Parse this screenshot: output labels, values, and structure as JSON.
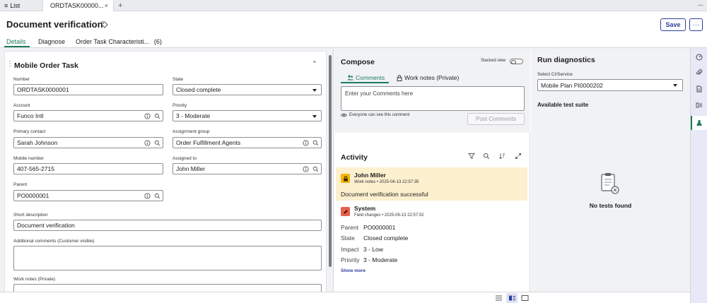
{
  "tabstrip": {
    "list_label": "List",
    "active_tab_label": "ORDTASK00000...",
    "close_glyph": "×",
    "plus_glyph": "+",
    "more_glyph": "···"
  },
  "header": {
    "title": "Document verification",
    "save_label": "Save",
    "more_label": "···"
  },
  "form_tabs": {
    "details": "Details",
    "diagnose": "Diagnose",
    "characteristics": "Order Task Characteristi...",
    "characteristics_count": "(6)"
  },
  "card": {
    "title": "Mobile Order Task",
    "drag_glyph": "⋮",
    "collapse_glyph": "⌃"
  },
  "fields": {
    "number": {
      "label": "Number",
      "value": "ORDTASK0000001"
    },
    "state": {
      "label": "State",
      "value": "Closed complete"
    },
    "account": {
      "label": "Account",
      "value": "Funco Intl"
    },
    "priority": {
      "label": "Priority",
      "value": "3 - Moderate"
    },
    "primary_contact": {
      "label": "Primary contact",
      "value": "Sarah Johnson"
    },
    "assignment_group": {
      "label": "Assignment group",
      "value": "Order Fulfillment Agents"
    },
    "mobile_number": {
      "label": "Mobile number",
      "value": "407-565-2715"
    },
    "assigned_to": {
      "label": "Assigned to",
      "value": "John Miller"
    },
    "parent": {
      "label": "Parent",
      "value": "PO0000001"
    },
    "short_description": {
      "label": "Short description",
      "value": "Document verification"
    },
    "additional_comments": {
      "label": "Additional comments (Customer visible)"
    },
    "work_notes": {
      "label": "Work notes (Private)"
    }
  },
  "compose": {
    "title": "Compose",
    "stacked_view_label": "Stacked view",
    "tab_comments": "Comments",
    "tab_work_notes": "Work notes (Private)",
    "comment_placeholder": "Enter your Comments here",
    "visibility_note": "Everyone can see this comment",
    "post_label": "Post Comments"
  },
  "activity": {
    "title": "Activity",
    "entry1": {
      "name": "John Miller",
      "meta": "Work notes • 2025-06-13 22:57:35",
      "text": "Document verification successful"
    },
    "entry2": {
      "name": "System",
      "meta": "Field changes • 2025-06-13 22:57:02",
      "changes": [
        {
          "key": "Parent",
          "value": "PO0000001"
        },
        {
          "key": "State",
          "value": "Closed complete"
        },
        {
          "key": "Impact",
          "value": "3 - Low"
        },
        {
          "key": "Priority",
          "value": "3 - Moderate"
        }
      ]
    },
    "show_more": "Show more"
  },
  "diagnostics": {
    "title": "Run diagnostics",
    "ci_label": "Select CI/Service",
    "ci_value": "Mobile Plan PI0000202",
    "suite_label": "Available test suite",
    "empty_text": "No tests found"
  },
  "colors": {
    "accent_green": "#1d7c5c",
    "primary_blue": "#2b3e9b",
    "worknote_bg": "#fcf0cf",
    "system_avatar": "#e8604c",
    "worknote_avatar": "#f4b400"
  },
  "icons": {
    "menu": "hamburger-icon",
    "tag": "tag-icon",
    "info": "info-icon",
    "search": "search-icon",
    "lock": "lock-icon",
    "people": "people-icon",
    "eye": "eye-icon",
    "filter": "filter-icon",
    "sort": "sort-icon",
    "expand": "expand-icon",
    "pencil": "pencil-icon",
    "clipboard": "clipboard-icon"
  }
}
